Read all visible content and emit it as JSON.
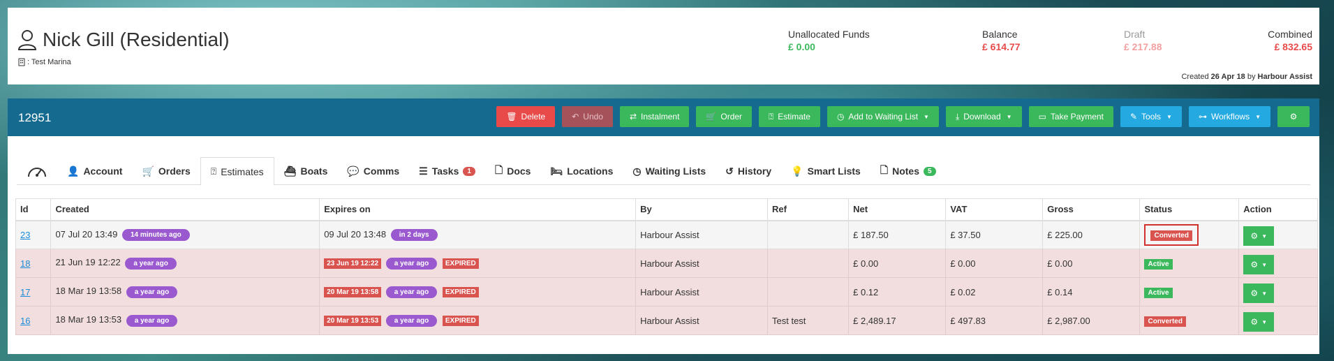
{
  "header": {
    "customer_name": "Nick Gill (Residential)",
    "marina": ": Test Marina",
    "stats": [
      {
        "label": "Unallocated Funds",
        "value": "£ 0.00",
        "color": "#3cb85c"
      },
      {
        "label": "Balance",
        "value": "£ 614.77",
        "color": "#e84a4a"
      },
      {
        "label": "Draft",
        "value": "£ 217.88",
        "color": "#f2a0a0"
      },
      {
        "label": "Combined",
        "value": "£ 832.65",
        "color": "#e84a4a"
      }
    ],
    "created_prefix": "Created",
    "created_date": "26 Apr 18",
    "created_by_prefix": "by",
    "created_by": "Harbour Assist"
  },
  "panel": {
    "id": "12951",
    "toolbar": {
      "delete": "Delete",
      "undo": "Undo",
      "instalment": "Instalment",
      "order": "Order",
      "estimate": "Estimate",
      "waiting_list": "Add to Waiting List",
      "download": "Download",
      "take_payment": "Take Payment",
      "tools": "Tools",
      "workflows": "Workflows"
    }
  },
  "tabs": {
    "account": "Account",
    "orders": "Orders",
    "estimates": "Estimates",
    "boats": "Boats",
    "comms": "Comms",
    "tasks": "Tasks",
    "tasks_count": "1",
    "docs": "Docs",
    "locations": "Locations",
    "waiting_lists": "Waiting Lists",
    "history": "History",
    "smart_lists": "Smart Lists",
    "notes": "Notes",
    "notes_count": "5"
  },
  "table": {
    "headers": [
      "Id",
      "Created",
      "Expires on",
      "By",
      "Ref",
      "Net",
      "VAT",
      "Gross",
      "Status",
      "Action"
    ],
    "rows": [
      {
        "id": "23",
        "created": "07 Jul 20 13:49",
        "created_ago": "14 minutes ago",
        "expires": "09 Jul 20 13:48",
        "expires_ago": "in 2 days",
        "expired": "",
        "by": "Harbour Assist",
        "ref": "",
        "net": "£ 187.50",
        "vat": "£ 37.50",
        "gross": "£ 225.00",
        "status": "Converted"
      },
      {
        "id": "18",
        "created": "21 Jun 19 12:22",
        "created_ago": "a year ago",
        "expires": "23 Jun 19 12:22",
        "expires_ago": "a year ago",
        "expired": "EXPIRED",
        "by": "Harbour Assist",
        "ref": "",
        "net": "£ 0.00",
        "vat": "£ 0.00",
        "gross": "£ 0.00",
        "status": "Active"
      },
      {
        "id": "17",
        "created": "18 Mar 19 13:58",
        "created_ago": "a year ago",
        "expires": "20 Mar 19 13:58",
        "expires_ago": "a year ago",
        "expired": "EXPIRED",
        "by": "Harbour Assist",
        "ref": "",
        "net": "£ 0.12",
        "vat": "£ 0.02",
        "gross": "£ 0.14",
        "status": "Active"
      },
      {
        "id": "16",
        "created": "18 Mar 19 13:53",
        "created_ago": "a year ago",
        "expires": "20 Mar 19 13:53",
        "expires_ago": "a year ago",
        "expired": "EXPIRED",
        "by": "Harbour Assist",
        "ref": "Test test",
        "net": "£ 2,489.17",
        "vat": "£ 497.83",
        "gross": "£ 2,987.00",
        "status": "Converted"
      }
    ]
  }
}
